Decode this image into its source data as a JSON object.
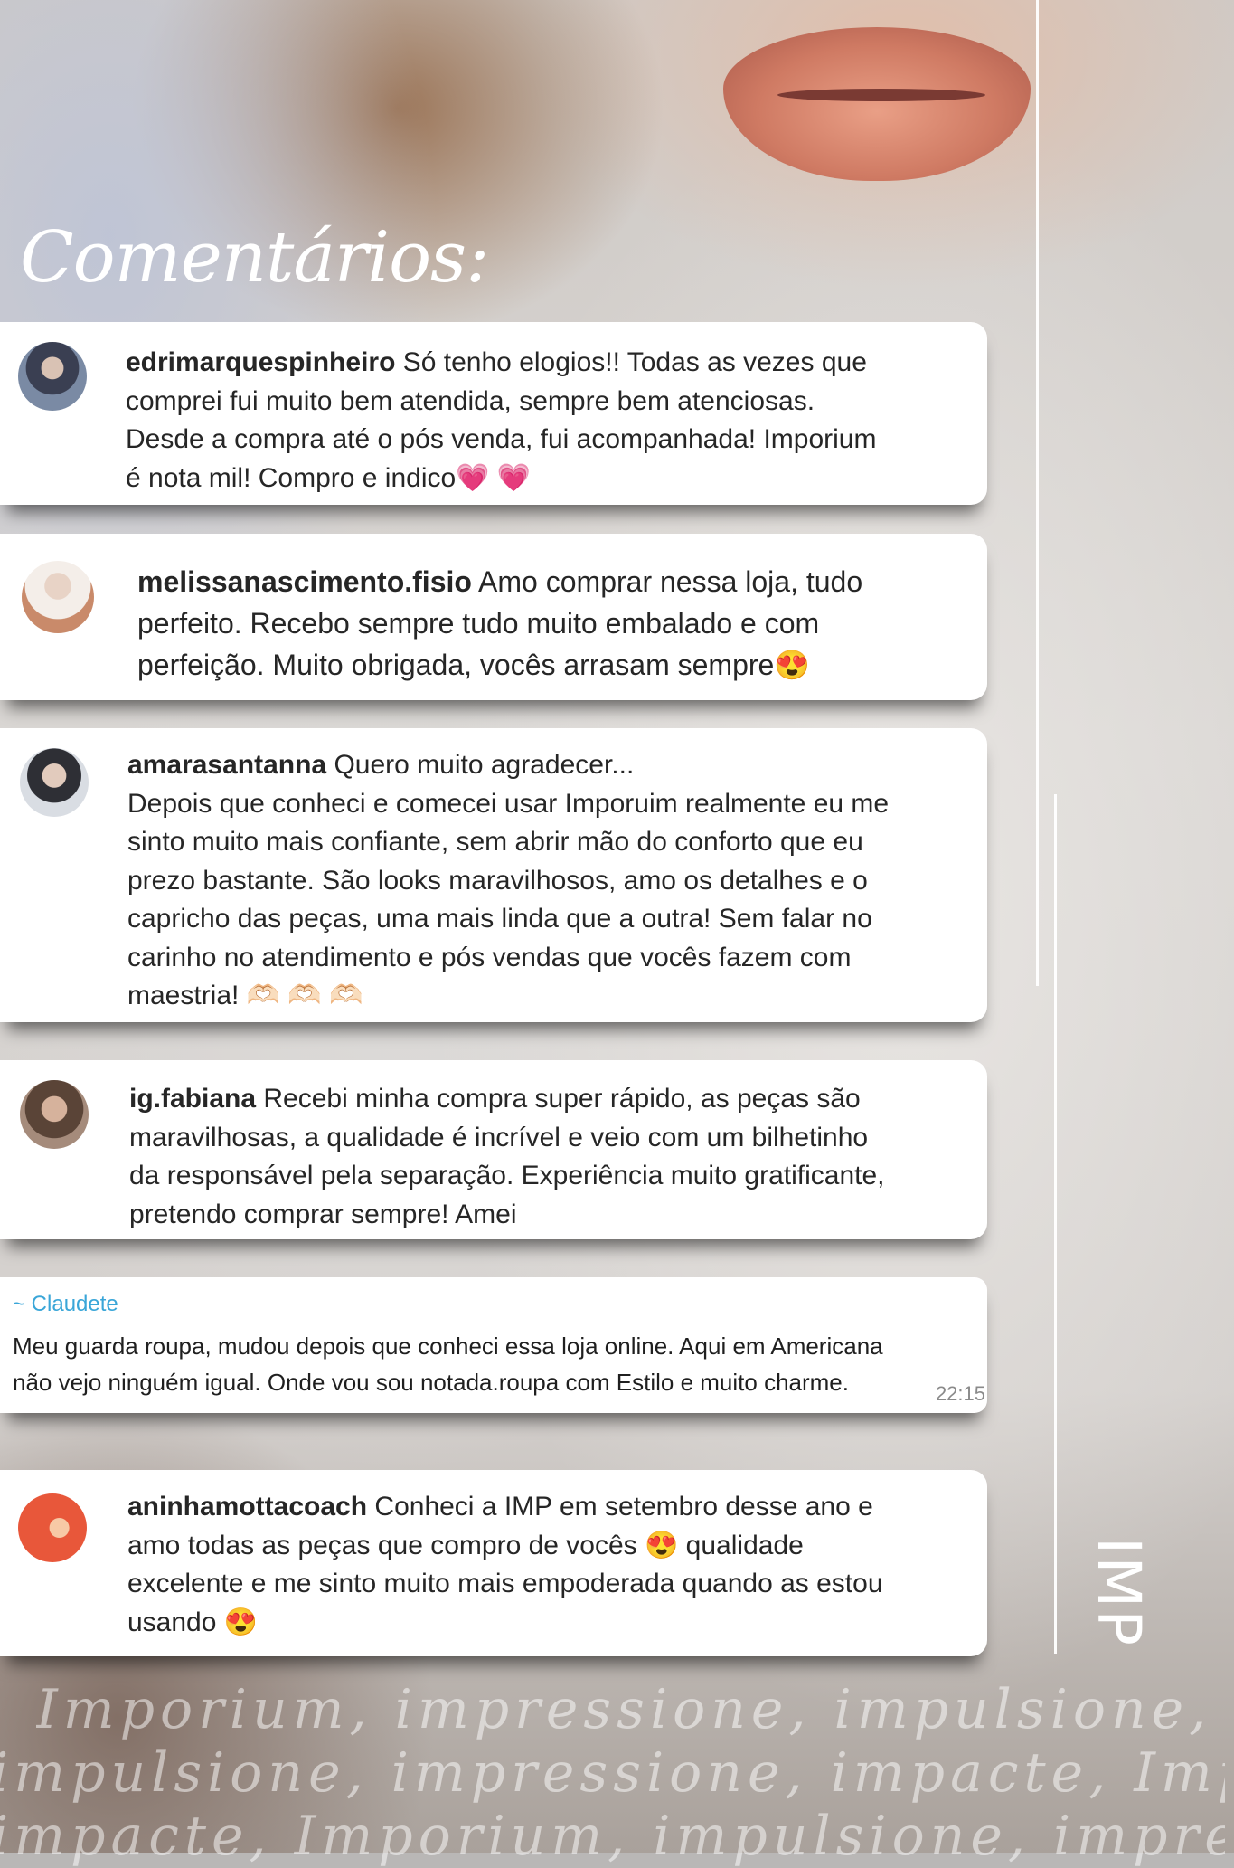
{
  "title": "Comentários:",
  "comments": [
    {
      "user": "edrimarquespinheiro",
      "text": "Só tenho elogios!! Todas as vezes que\ncomprei fui muito bem atendida, sempre bem atenciosas.\nDesde a compra até o pós venda, fui acompanhada! Imporium\né nota mil! Compro e indico💗 💗"
    },
    {
      "user": "melissanascimento.fisio",
      "text": "Amo comprar nessa loja, tudo\nperfeito. Recebo sempre tudo muito embalado e com\nperfeição. Muito obrigada, vocês arrasam sempre😍"
    },
    {
      "user": "amarasantanna",
      "text": "Quero muito agradecer...\nDepois que conheci e comecei usar Imporuim realmente eu me\nsinto muito mais confiante, sem abrir mão do conforto que eu\nprezo bastante. São looks maravilhosos, amo os detalhes e o\ncapricho das peças, uma mais linda que a outra! Sem falar no\ncarinho no atendimento e pós vendas que vocês fazem com\nmaestria! 🫶🏻 🫶🏻 🫶🏻"
    },
    {
      "user": "ig.fabiana",
      "text": "Recebi minha compra super rápido, as peças são\nmaravilhosas, a qualidade é incrível e veio com um bilhetinho\nda responsável pela separação. Experiência muito gratificante,\npretendo comprar sempre! Amei"
    }
  ],
  "whatsapp": {
    "name": "~ Claudete",
    "text": "Meu guarda roupa, mudou depois que conheci essa loja online. Aqui em Americana\nnão vejo ninguém igual. Onde vou sou notada.roupa com Estilo e muito charme.",
    "time": "22:15"
  },
  "last_comment": {
    "user": "aninhamottacoach",
    "text": "Conheci a IMP em setembro desse ano e\namo todas as peças que compro de vocês 😍 qualidade\nexcelente e me sinto muito mais empoderada quando as estou\nusando 😍"
  },
  "logo": "IMP",
  "watermark": [
    "Imporium, impressione, impulsione, impacte,",
    "impulsione, impressione, impacte, Imporium,",
    "impacte, Imporium, impulsione, impressione, I"
  ]
}
